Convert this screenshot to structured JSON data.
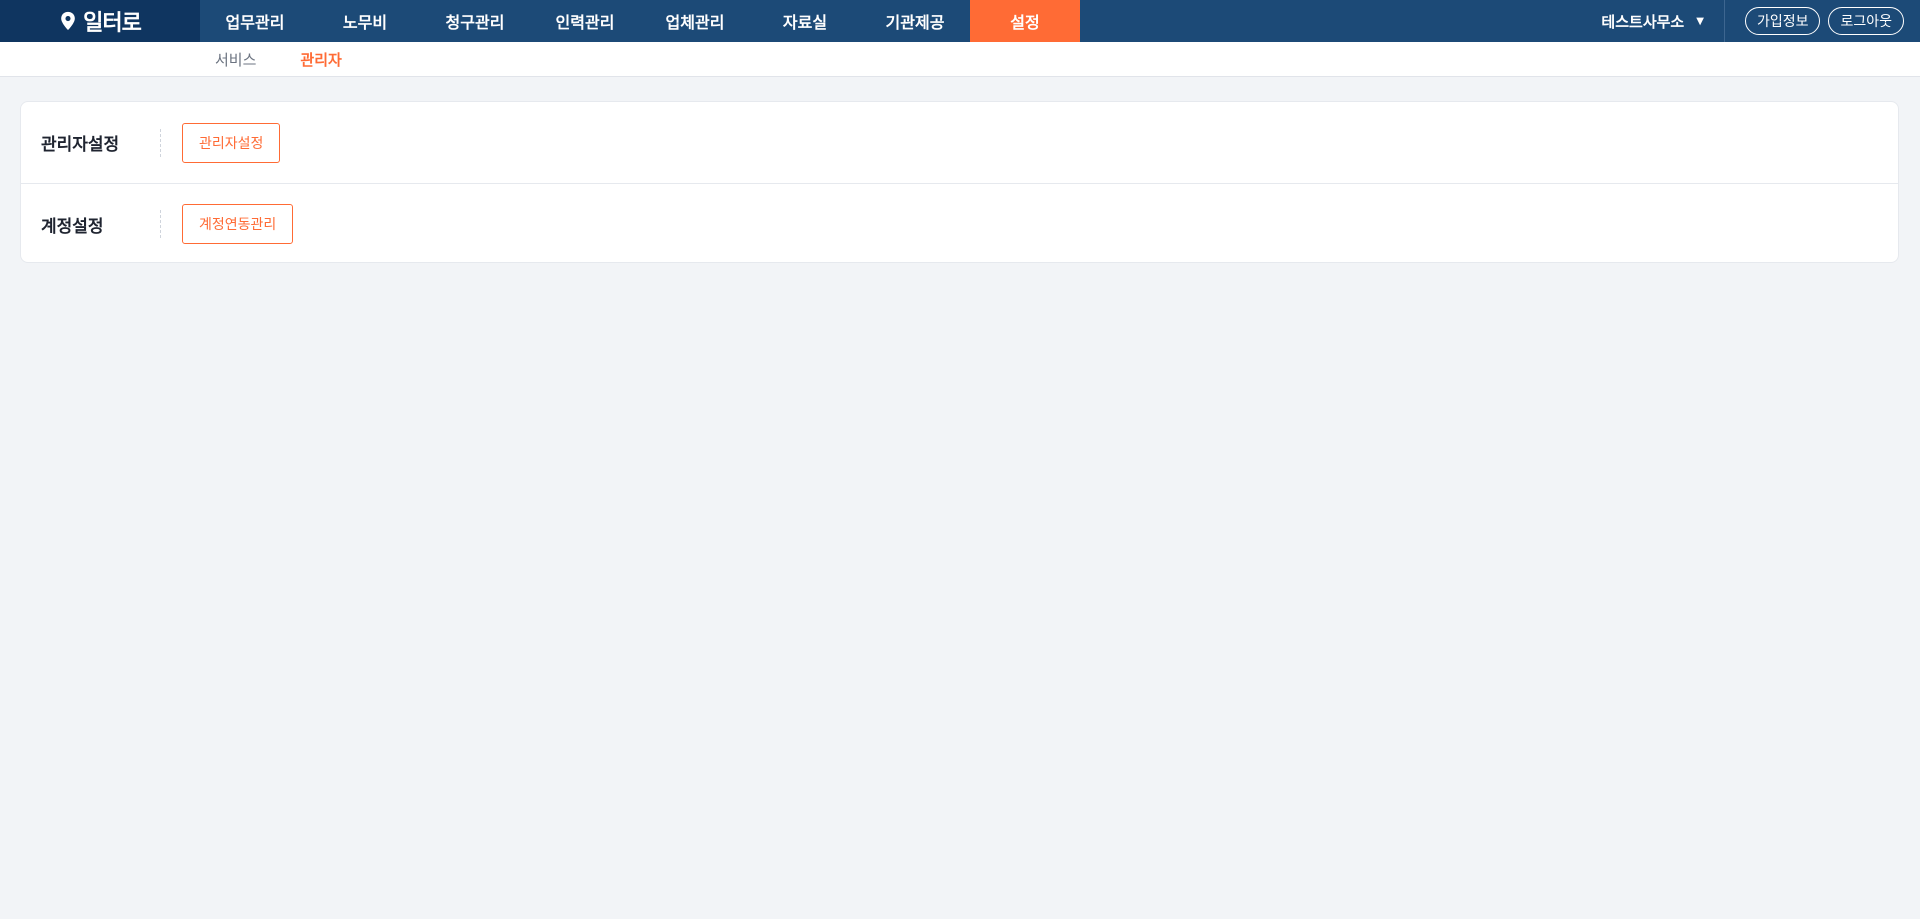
{
  "header": {
    "logo_text": "일터로",
    "nav": [
      {
        "label": "업무관리"
      },
      {
        "label": "노무비"
      },
      {
        "label": "청구관리"
      },
      {
        "label": "인력관리"
      },
      {
        "label": "업체관리"
      },
      {
        "label": "자료실"
      },
      {
        "label": "기관제공"
      },
      {
        "label": "설정",
        "active": true
      }
    ],
    "office_name": "테스트사무소",
    "office_caret": "▼",
    "join_info_label": "가입정보",
    "logout_label": "로그아웃"
  },
  "subnav": {
    "items": [
      {
        "label": "서비스"
      },
      {
        "label": "관리자",
        "active": true
      }
    ]
  },
  "settings": {
    "rows": [
      {
        "label": "관리자설정",
        "button": "관리자설정"
      },
      {
        "label": "계정설정",
        "button": "계정연동관리"
      }
    ]
  },
  "colors": {
    "topbar": "#1c4a77",
    "logo_bg": "#0f3560",
    "accent": "#ff6b35",
    "background": "#f2f4f7"
  },
  "icons": {
    "logo": "location-pin-icon",
    "office_dropdown": "caret-down-icon"
  }
}
